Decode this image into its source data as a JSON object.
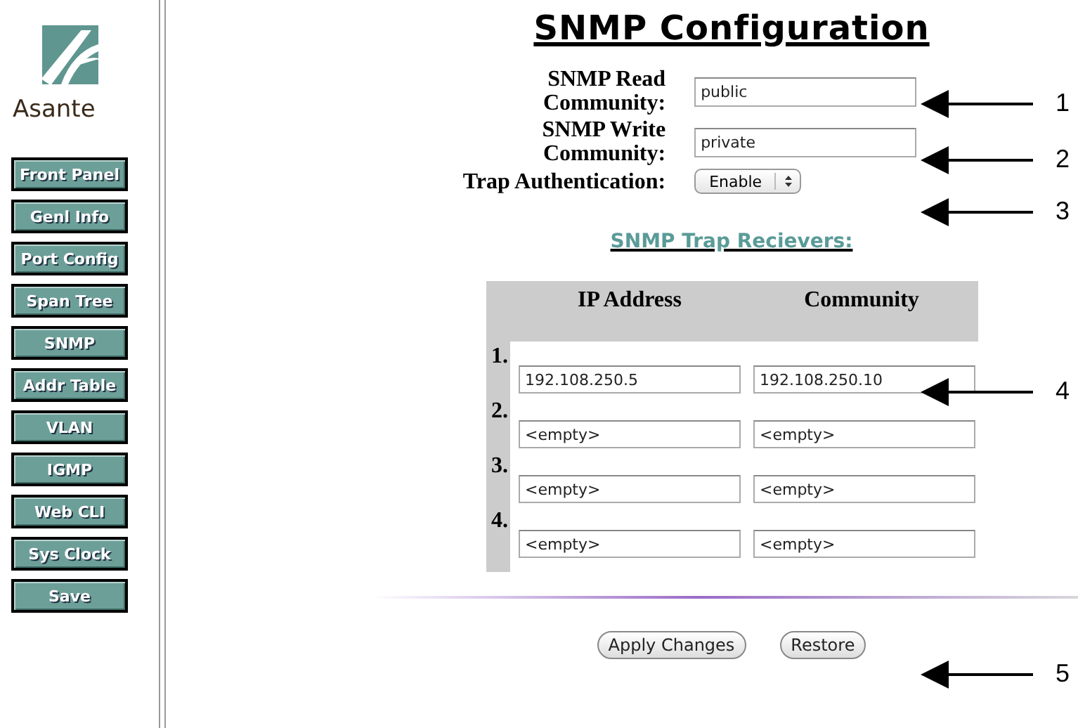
{
  "sidebar": {
    "brand": "Asante",
    "items": [
      "Front Panel",
      "Genl Info",
      "Port Config",
      "Span Tree",
      "SNMP",
      "Addr Table",
      "VLAN",
      "IGMP",
      "Web CLI",
      "Sys Clock",
      "Save"
    ]
  },
  "title": "SNMP Configuration",
  "fields": [
    {
      "kind": "text",
      "label": "SNMP Read Community:",
      "value": "public"
    },
    {
      "kind": "text",
      "label": "SNMP Write Community:",
      "value": "private"
    },
    {
      "kind": "select",
      "label": "Trap Authentication:",
      "value": "Enable"
    }
  ],
  "receivers": {
    "title": "SNMP Trap Recievers:",
    "columns": [
      "IP Address",
      "Community"
    ],
    "rows": [
      {
        "number": "1.",
        "ip": "192.108.250.5",
        "community": "192.108.250.10"
      },
      {
        "number": "2.",
        "ip": "<empty>",
        "community": "<empty>"
      },
      {
        "number": "3.",
        "ip": "<empty>",
        "community": "<empty>"
      },
      {
        "number": "4.",
        "ip": "<empty>",
        "community": "<empty>"
      }
    ]
  },
  "buttons": [
    "Apply Changes",
    "Restore"
  ],
  "callouts": [
    "1",
    "2",
    "3",
    "4",
    "5"
  ]
}
